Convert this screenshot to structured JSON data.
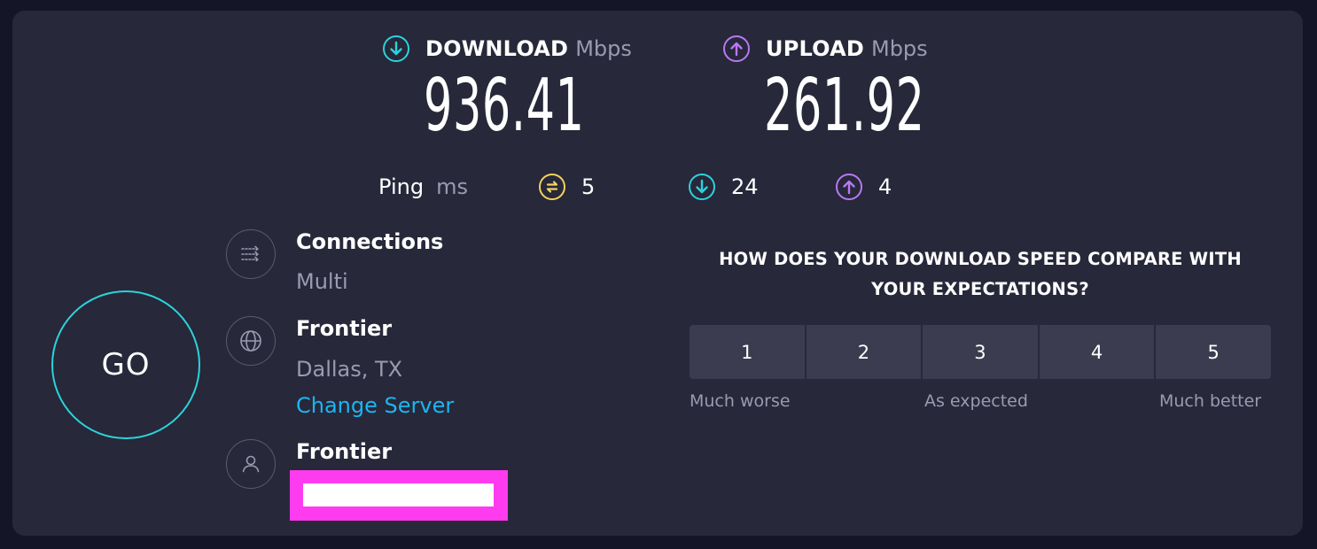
{
  "download": {
    "title": "DOWNLOAD",
    "unit": "Mbps",
    "value": "936.41",
    "icon": "arrow-down-circle-icon",
    "color": "#2bd3dc"
  },
  "upload": {
    "title": "UPLOAD",
    "unit": "Mbps",
    "value": "261.92",
    "icon": "arrow-up-circle-icon",
    "color": "#b779f5"
  },
  "ping": {
    "label": "Ping",
    "unit": "ms",
    "idle": "5",
    "download": "24",
    "upload": "4",
    "idle_color": "#f3d25f"
  },
  "go_button": {
    "label": "GO",
    "color": "#2bd3dc"
  },
  "connections": {
    "title": "Connections",
    "value": "Multi",
    "icon": "connections-arrows-icon"
  },
  "server": {
    "title": "Frontier",
    "location": "Dallas, TX",
    "change_label": "Change Server",
    "icon": "globe-icon",
    "link_color": "#1cb5f2"
  },
  "provider": {
    "title": "Frontier",
    "icon": "user-icon"
  },
  "survey": {
    "question": "HOW DOES YOUR DOWNLOAD SPEED COMPARE WITH YOUR EXPECTATIONS?",
    "options": [
      "1",
      "2",
      "3",
      "4",
      "5"
    ],
    "low_label": "Much worse",
    "mid_label": "As expected",
    "high_label": "Much better"
  }
}
